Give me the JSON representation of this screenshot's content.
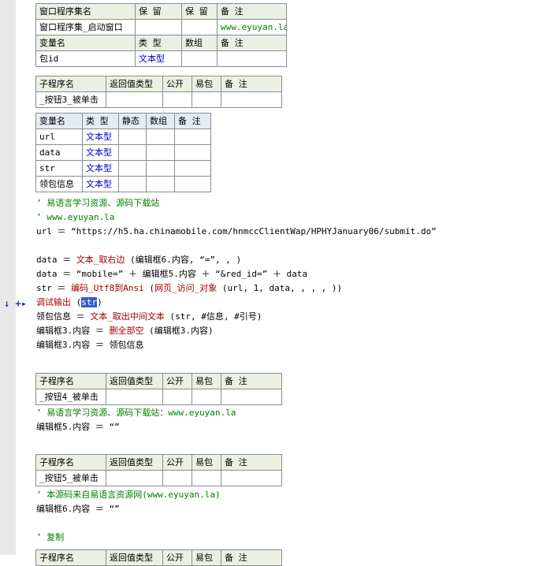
{
  "table1": {
    "hdr": [
      "窗口程序集名",
      "保 留",
      "保 留",
      "备 注"
    ],
    "row": [
      "窗口程序集_启动窗口",
      "",
      "",
      "www.eyuyan.la"
    ],
    "vhdr": [
      "变量名",
      "类 型",
      "数组",
      "备 注"
    ],
    "vrow": [
      "包id",
      "文本型",
      "",
      ""
    ]
  },
  "sub1": {
    "hdr": [
      "子程序名",
      "返回值类型",
      "公开",
      "易包",
      "备 注"
    ],
    "row": [
      "_按钮3_被单击",
      "",
      "",
      "",
      ""
    ]
  },
  "vars1": {
    "hdr": [
      "变量名",
      "类 型",
      "静态",
      "数组",
      "备 注"
    ],
    "rows": [
      [
        "url",
        "文本型"
      ],
      [
        "data",
        "文本型"
      ],
      [
        "str",
        "文本型"
      ],
      [
        "领包信息",
        "文本型"
      ]
    ]
  },
  "code1": {
    "c1": "’ 易语言学习资源、源码下载站",
    "c2": "’ www.eyuyan.la",
    "l1": "url ＝ “https://h5.ha.chinamobile.com/hnmccClientWap/HPHYJanuary06/submit.do”",
    "l2a": "data ＝ ",
    "l2b": "文本_取右边",
    "l2c": " (编辑框6.内容, “=”, , )",
    "l3": "data ＝ “mobile=” ＋ 编辑框5.内容 ＋ “&red_id=” ＋ data",
    "l4a": "str ＝ ",
    "l4b": "编码_Utf8到Ansi",
    "l4c": " (",
    "l4d": "网页_访问_对象",
    "l4e": " (url, 1, data, , , , ))",
    "l5a": "调试输出",
    "l5b": " (",
    "l5c": "str",
    "l5d": ")",
    "l6a": "领包信息 ＝ ",
    "l6b": "文本_取出中间文本",
    "l6c": " (str, #信息, #引号)",
    "l7a": "编辑框3.内容 ＝ ",
    "l7b": "删全部空",
    "l7c": " (编辑框3.内容)",
    "l8": "编辑框3.内容 ＝ 领包信息"
  },
  "sub2": {
    "hdr": [
      "子程序名",
      "返回值类型",
      "公开",
      "易包",
      "备 注"
    ],
    "row": [
      "_按钮4_被单击",
      "",
      "",
      "",
      ""
    ]
  },
  "code2": {
    "c1": "’ 易语言学习资源、源码下载站：www.eyuyan.la",
    "l1": "编辑框5.内容 ＝ “”"
  },
  "sub3": {
    "hdr": [
      "子程序名",
      "返回值类型",
      "公开",
      "易包",
      "备 注"
    ],
    "row": [
      "_按钮5_被单击",
      "",
      "",
      "",
      ""
    ]
  },
  "code3": {
    "c1": "’ 本源码来自易语言资源网(www.eyuyan.la)",
    "l1": "编辑框6.内容 ＝ “”",
    "c2": "’ 复制"
  },
  "sub4": {
    "hdr": [
      "子程序名",
      "返回值类型",
      "公开",
      "易包",
      "备 注"
    ]
  },
  "markers": {
    "arrow": "↓",
    "plus": "+▸"
  }
}
